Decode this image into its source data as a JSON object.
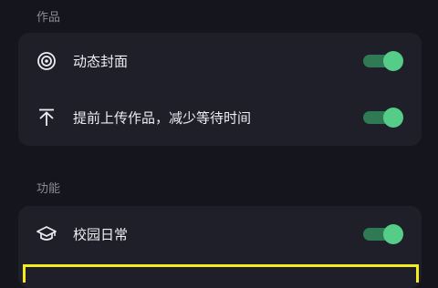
{
  "sections": {
    "works": {
      "title": "作品",
      "items": [
        {
          "icon": "dynamic-cover-icon",
          "label": "动态封面",
          "enabled": true
        },
        {
          "icon": "upload-icon",
          "label": "提前上传作品，减少等待时间",
          "enabled": true
        }
      ]
    },
    "features": {
      "title": "功能",
      "items": [
        {
          "icon": "graduation-cap-icon",
          "label": "校园日常",
          "enabled": true
        }
      ]
    }
  },
  "colors": {
    "background": "#14151d",
    "card": "#1e1f28",
    "toggle_track": "#2f7a55",
    "toggle_knob": "#55cc88",
    "highlight": "#f4ec20"
  }
}
